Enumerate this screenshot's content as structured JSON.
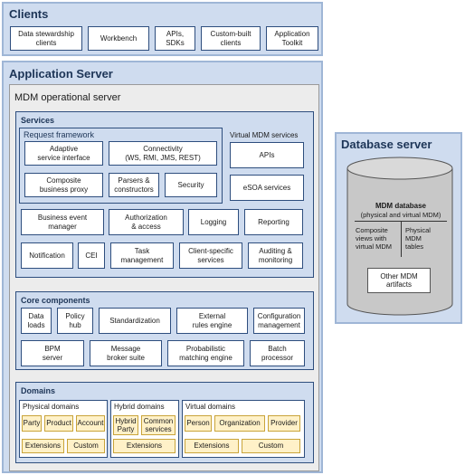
{
  "clients": {
    "title": "Clients",
    "items": [
      "Data stewardship\nclients",
      "Workbench",
      "APIs,\nSDKs",
      "Custom-built\nclients",
      "Application\nToolkit"
    ]
  },
  "app_server": {
    "title": "Application Server",
    "mdm_server": {
      "title": "MDM operational server",
      "services": {
        "title": "Services",
        "request_framework": {
          "title": "Request framework",
          "items": [
            "Adaptive\nservice interface",
            "Connectivity\n(WS, RMI, JMS, REST)",
            "Composite\nbusiness proxy",
            "Parsers &\nconstructors",
            "Security"
          ]
        },
        "virtual_mdm": {
          "title": "Virtual MDM services",
          "items": [
            "APIs",
            "eSOA services"
          ]
        },
        "row1": [
          "Business event\nmanager",
          "Authorization\n& access",
          "Logging",
          "Reporting"
        ],
        "row2": [
          "Notification",
          "CEI",
          "Task\nmanagement",
          "Client-specific\nservices",
          "Auditing &\nmonitoring"
        ]
      },
      "core": {
        "title": "Core components",
        "row1": [
          "Data\nloads",
          "Policy\nhub",
          "Standardization",
          "External\nrules engine",
          "Configuration\nmanagement"
        ],
        "row2": [
          "BPM\nserver",
          "Message\nbroker suite",
          "Probabilistic\nmatching engine",
          "Batch\nprocessor"
        ]
      },
      "domains": {
        "title": "Domains",
        "physical": {
          "title": "Physical domains",
          "items": [
            "Party",
            "Product",
            "Account",
            "Extensions",
            "Custom"
          ]
        },
        "hybrid": {
          "title": "Hybrid domains",
          "items": [
            "Hybrid\nParty",
            "Common\nservices",
            "Extensions"
          ]
        },
        "virtual": {
          "title": "Virtual domains",
          "items": [
            "Person",
            "Organization",
            "Provider",
            "Extensions",
            "Custom"
          ]
        }
      }
    }
  },
  "database": {
    "title": "Database server",
    "mdm_db_title": "MDM database",
    "mdm_db_subtitle": "(physical and virtual MDM)",
    "left_label": "Composite\nviews with\nvirtual MDM",
    "right_label": "Physical\nMDM\ntables",
    "other": "Other MDM\nartifacts"
  },
  "colors": {
    "panel_fill": "#cfdcef",
    "panel_border": "#9fb6d6",
    "box_border": "#2e4e7e",
    "domain_item_fill": "#fff1c8",
    "cylinder_fill": "#c8c8c8"
  }
}
